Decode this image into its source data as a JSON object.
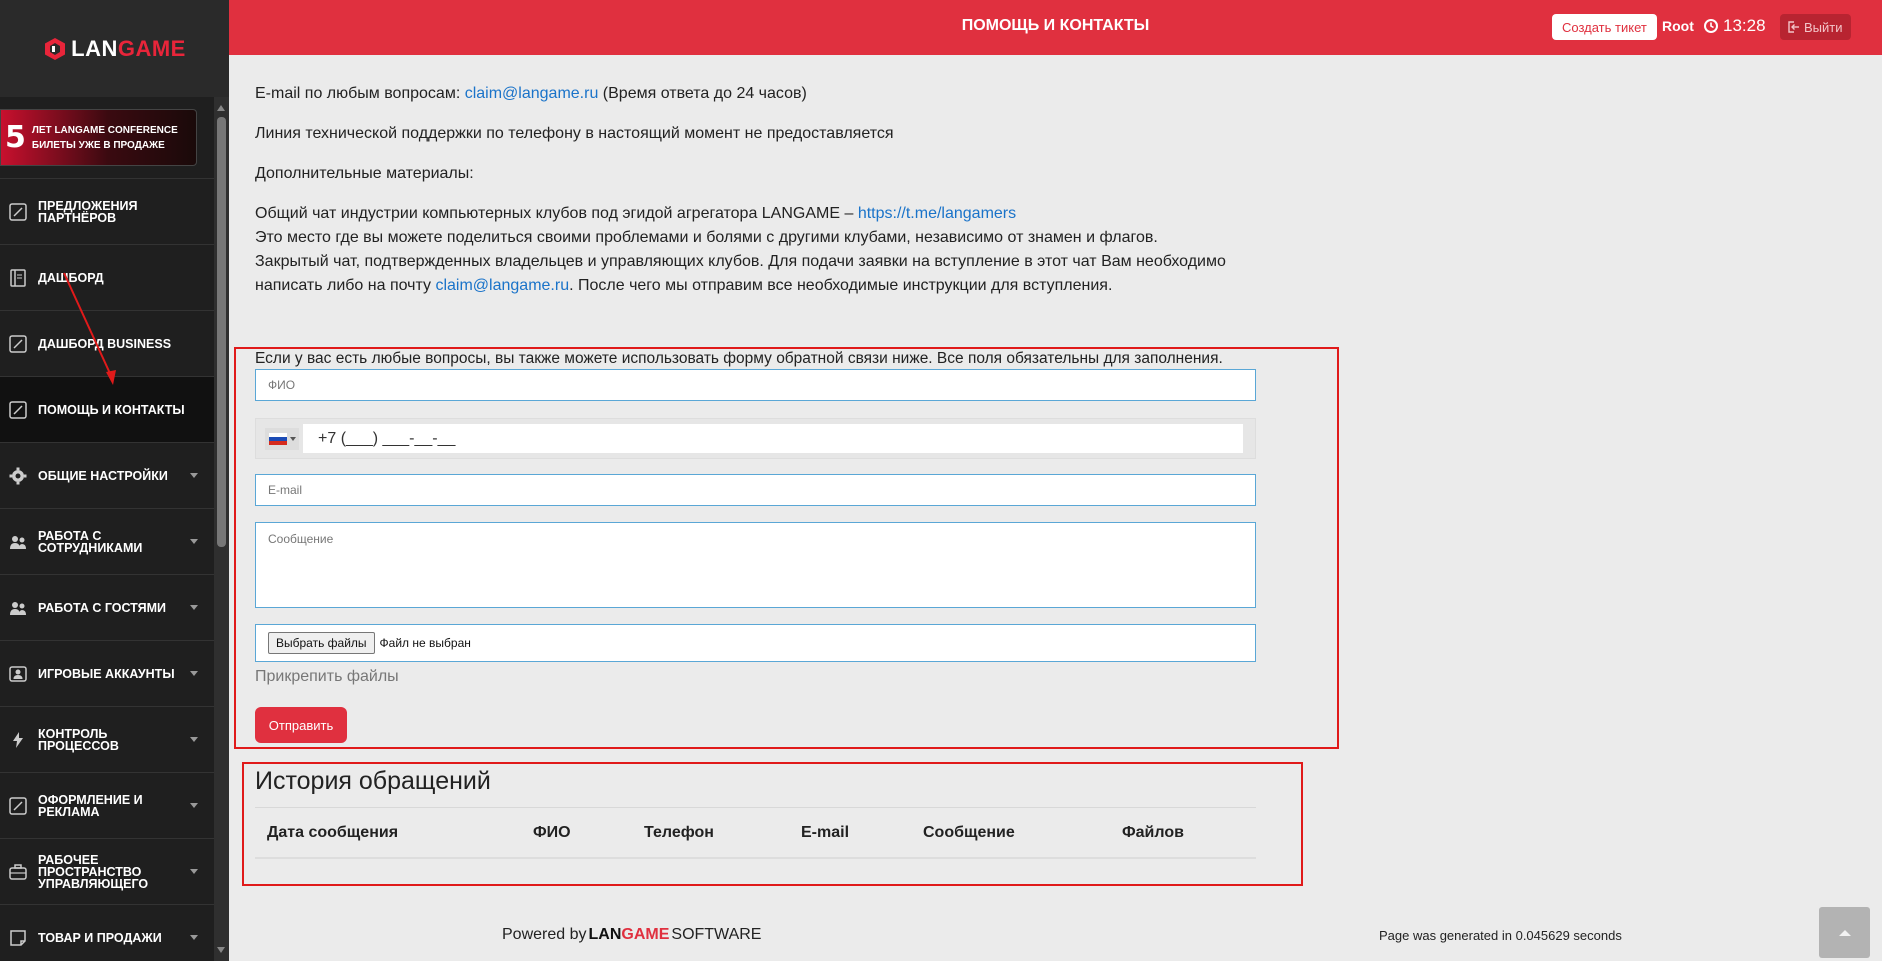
{
  "brand": {
    "logo_prefix": "LAN",
    "logo_suffix": "GAME"
  },
  "banner": {
    "number": "5",
    "line1": "лет LANGAME conference",
    "line2": "билеты уже в продаже"
  },
  "sidebar": {
    "items": [
      {
        "label": "Предложения партнёров",
        "icon": "edit-icon"
      },
      {
        "label": "Дашборд",
        "icon": "document-icon"
      },
      {
        "label": "Дашборд Business",
        "icon": "edit-icon"
      },
      {
        "label": "Помощь и контакты",
        "icon": "edit-icon",
        "active": true
      },
      {
        "label": "Общие настройки",
        "icon": "gear-icon"
      },
      {
        "label": "Работа с сотрудниками",
        "icon": "users-icon"
      },
      {
        "label": "Работа с гостями",
        "icon": "users-icon"
      },
      {
        "label": "Игровые аккаунты",
        "icon": "account-icon"
      },
      {
        "label": "Контроль процессов",
        "icon": "bolt-icon"
      },
      {
        "label": "Оформление и реклама",
        "icon": "edit-icon"
      },
      {
        "label": "Рабочее пространство управляющего",
        "icon": "briefcase-icon"
      },
      {
        "label": "Товар и продажи",
        "icon": "note-icon"
      }
    ]
  },
  "header": {
    "title": "ПОМОЩЬ И КОНТАКТЫ",
    "create_ticket": "Создать тикет",
    "user": "Root",
    "time": "13:28",
    "logout": "Выйти",
    "accent": "#e0303f"
  },
  "content": {
    "email_prefix": "E-mail по любым вопросам:",
    "email": "claim@langame.ru",
    "email_suffix": "(Время ответа до 24 часов)",
    "phone_note": "Линия технической поддержки по телефону в настоящий момент не предоставляется",
    "extra_title": "Дополнительные материалы:",
    "chat_prefix": "Общий чат индустрии компьютерных клубов под эгидой агрегатора LANGAME –",
    "chat_link": "https://t.me/langamers",
    "chat_desc": "Это место где вы можете поделиться своими проблемами и болями с другими клубами, независимо от знамен и флагов.",
    "closed_chat_1": "Закрытый чат, подтвержденных владельцев и управляющих клубов. Для подачи заявки на вступление в этот чат Вам необходимо",
    "closed_chat_2_prefix": "написать либо на почту",
    "closed_chat_2_email": "claim@langame.ru",
    "closed_chat_2_suffix": ". После чего мы отправим все необходимые инструкции для вступления."
  },
  "form": {
    "intro": "Если у вас есть любые вопросы, вы также можете использовать форму обратной связи ниже. Все поля обязательны для заполнения.",
    "name_placeholder": "ФИО",
    "phone_value": "+7 (___) ___-__-__",
    "email_placeholder": "E-mail",
    "message_placeholder": "Сообщение",
    "file_button": "Выбрать файлы",
    "file_status": "Файл не выбран",
    "attach_label": "Прикрепить файлы",
    "submit": "Отправить"
  },
  "history": {
    "title": "История обращений",
    "columns": [
      "Дата сообщения",
      "ФИО",
      "Телефон",
      "E-mail",
      "Сообщение",
      "Файлов"
    ]
  },
  "footer": {
    "powered": "Powered by",
    "brand_prefix": "LAN",
    "brand_suffix": "GAME",
    "software": "SOFTWARE",
    "generated": "Page was generated in 0.045629 seconds"
  }
}
